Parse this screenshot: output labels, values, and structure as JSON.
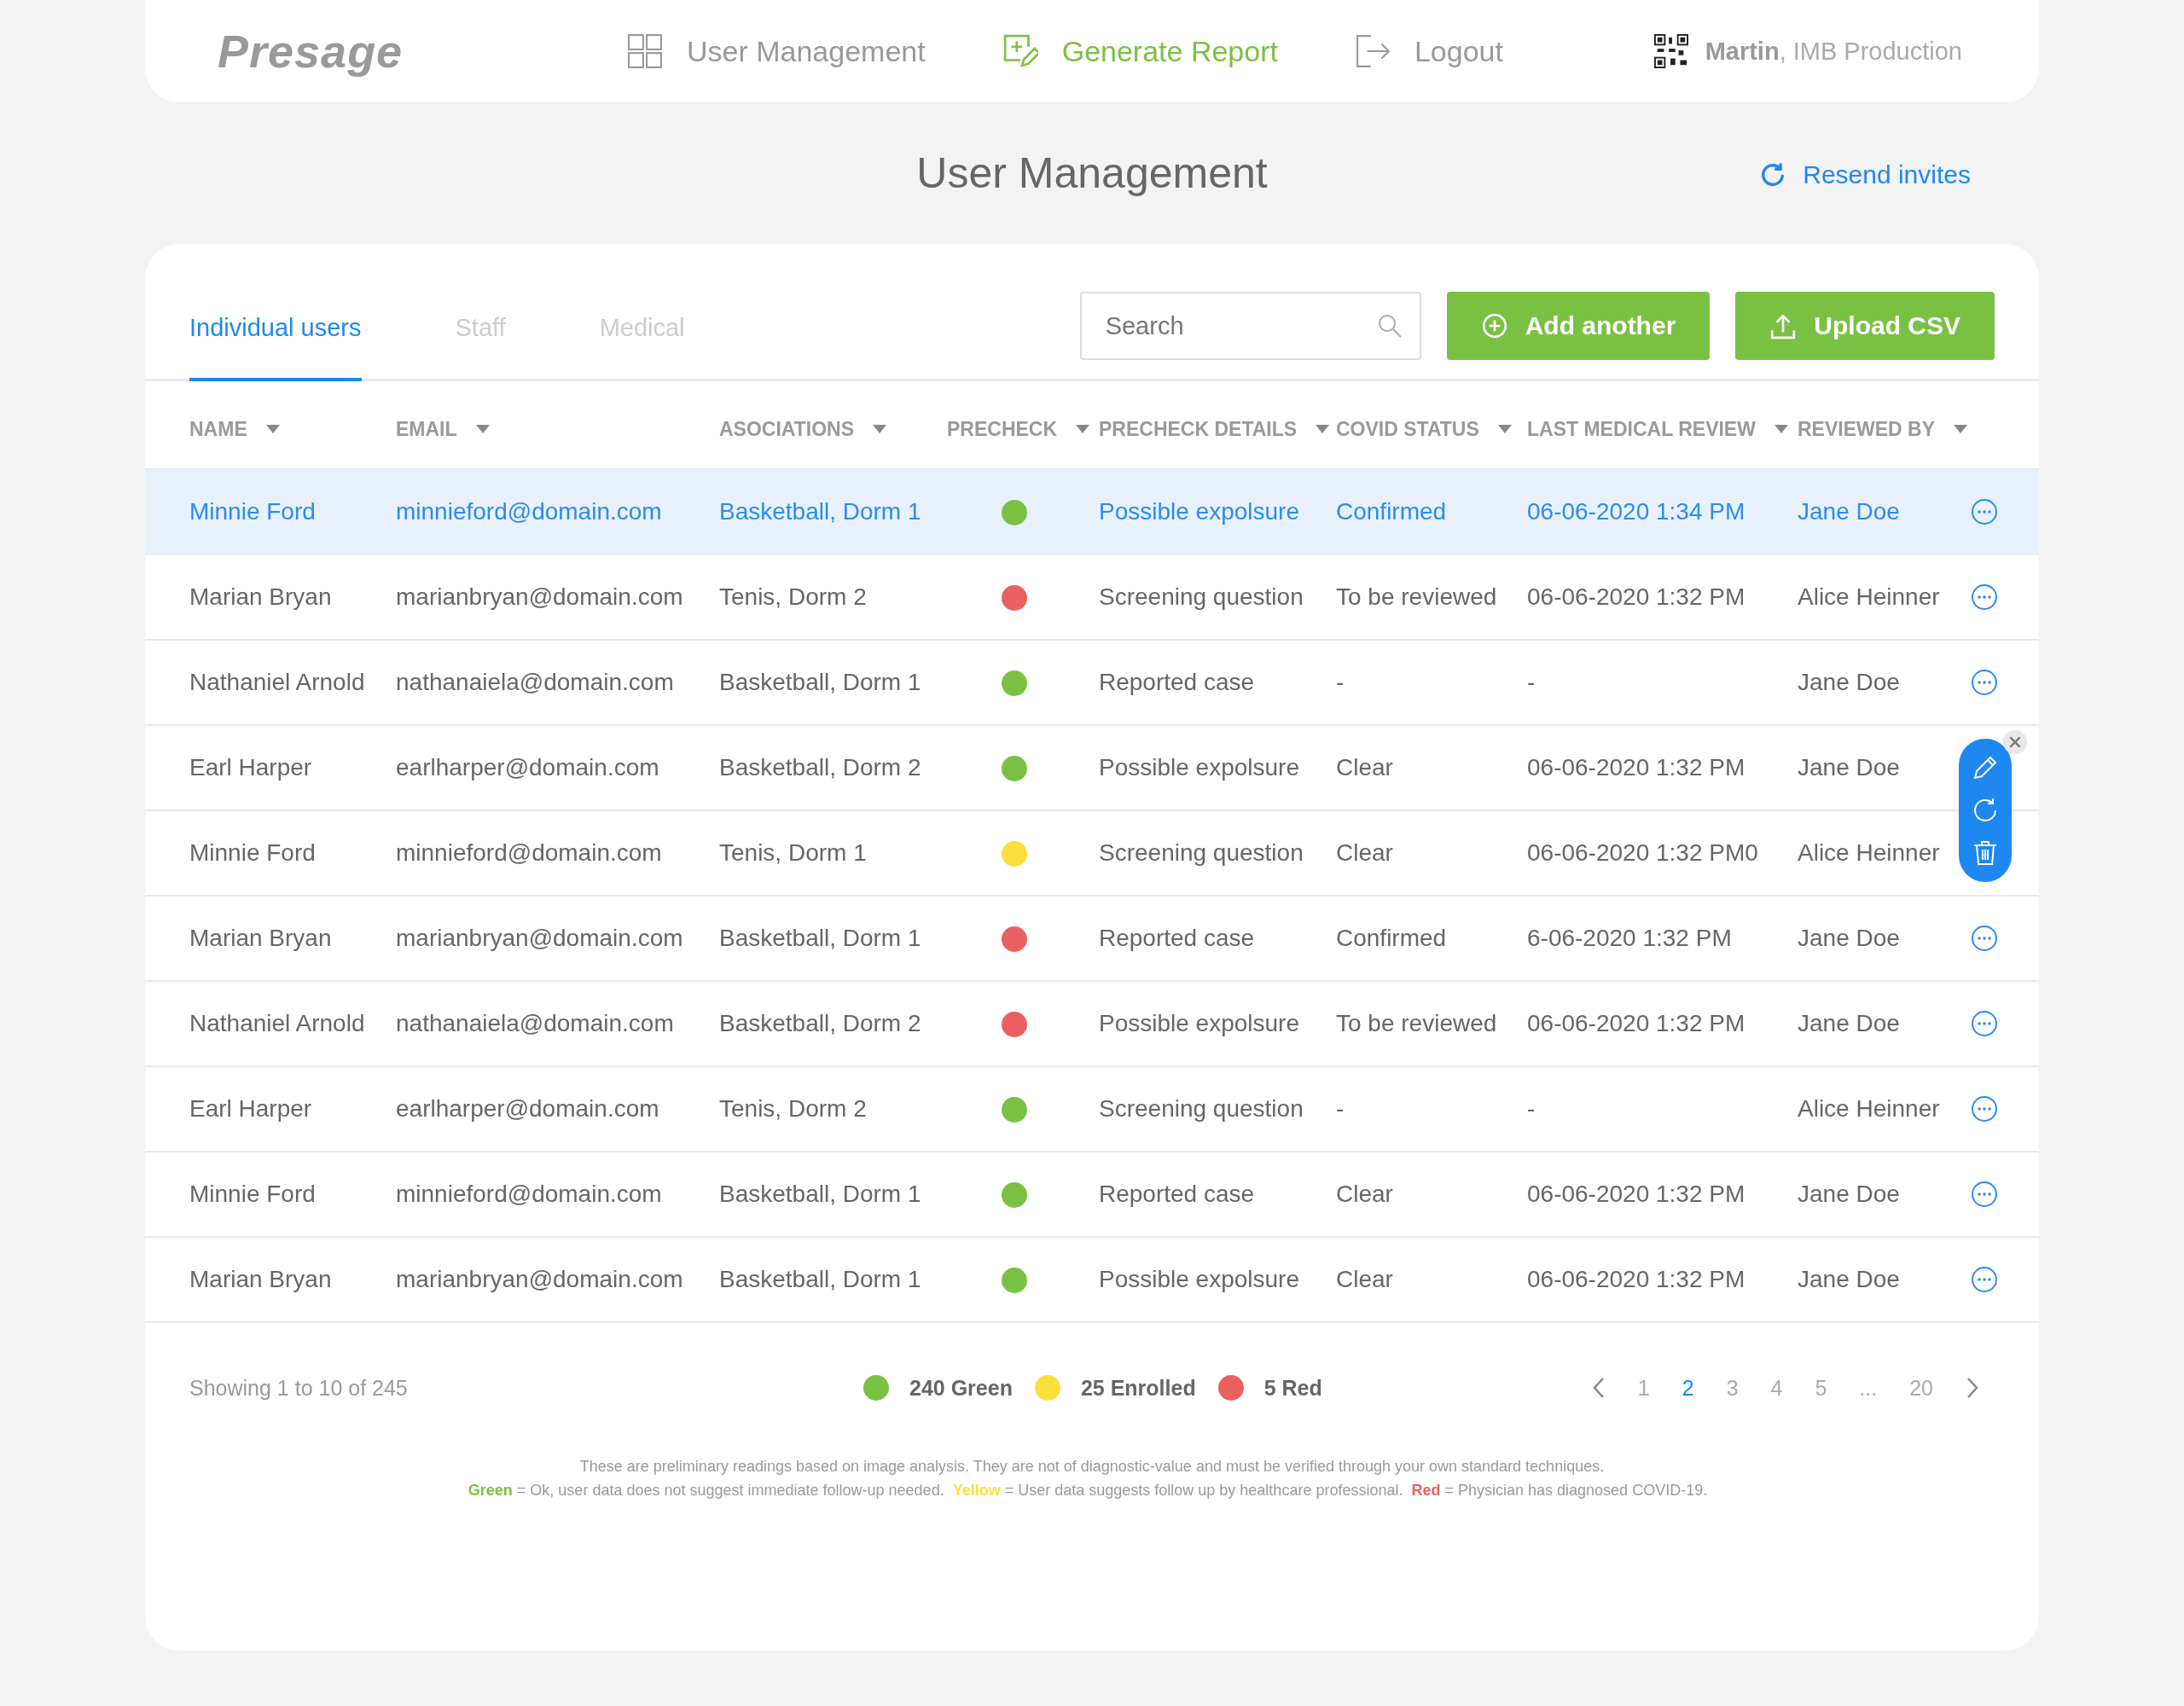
{
  "header": {
    "logo": "Presage",
    "nav": [
      {
        "label": "User Management",
        "selected": false
      },
      {
        "label": "Generate Report",
        "selected": true
      },
      {
        "label": "Logout",
        "selected": false
      }
    ],
    "user": {
      "name": "Martin",
      "org": ", IMB Production"
    }
  },
  "page_title": "User Management",
  "resend_link": "Resend invites",
  "tabs": [
    {
      "label": "Individual users",
      "selected": true
    },
    {
      "label": "Staff",
      "selected": false
    },
    {
      "label": "Medical",
      "selected": false
    }
  ],
  "search": {
    "placeholder": "Search"
  },
  "buttons": [
    {
      "label": "Add another",
      "kind": "add"
    },
    {
      "label": "Upload CSV",
      "kind": "upload"
    }
  ],
  "table": {
    "columns": [
      "NAME",
      "EMAIL",
      "ASOCIATIONS",
      "PRECHECK",
      "PRECHECK DETAILS",
      "COVID STATUS",
      "LAST MEDICAL REVIEW",
      "REVIEWED BY"
    ],
    "rows": [
      {
        "name": "Minnie Ford",
        "email": "minnieford@domain.com",
        "associations": "Basketball, Dorm 1",
        "color": "#7ac143",
        "details": "Possible expolsure",
        "covid_status": "Confirmed",
        "last_review": "06-06-2020 1:34 PM",
        "reviewed_by": "Jane Doe",
        "selected": true,
        "menu_open": false
      },
      {
        "name": "Marian Bryan",
        "email": "marianbryan@domain.com",
        "associations": "Tenis, Dorm 2",
        "color": "#ea6060",
        "details": "Screening question",
        "covid_status": "To be reviewed",
        "last_review": "06-06-2020 1:32 PM",
        "reviewed_by": "Alice Heinner",
        "selected": false,
        "menu_open": false
      },
      {
        "name": "Nathaniel Arnold",
        "email": "nathanaiela@domain.com",
        "associations": "Basketball, Dorm 1",
        "color": "#7ac143",
        "details": "Reported case",
        "covid_status": "-",
        "last_review": "-",
        "reviewed_by": "Jane Doe",
        "selected": false,
        "menu_open": false
      },
      {
        "name": "Earl Harper",
        "email": "earlharper@domain.com",
        "associations": "Basketball, Dorm 2",
        "color": "#7ac143",
        "details": "Possible expolsure",
        "covid_status": "Clear",
        "last_review": "06-06-2020 1:32 PM",
        "reviewed_by": "Jane Doe",
        "selected": false,
        "menu_open": true
      },
      {
        "name": "Minnie Ford",
        "email": "minnieford@domain.com",
        "associations": "Tenis, Dorm 1",
        "color": "#fddf3c",
        "details": "Screening question",
        "covid_status": "Clear",
        "last_review": "06-06-2020 1:32 PM0",
        "reviewed_by": "Alice Heinner",
        "selected": false,
        "menu_open": false
      },
      {
        "name": "Marian Bryan",
        "email": "marianbryan@domain.com",
        "associations": "Basketball, Dorm 1",
        "color": "#ea6060",
        "details": "Reported case",
        "covid_status": "Confirmed",
        "last_review": "6-06-2020 1:32 PM",
        "reviewed_by": "Jane Doe",
        "selected": false,
        "menu_open": false
      },
      {
        "name": "Nathaniel Arnold",
        "email": "nathanaiela@domain.com",
        "associations": "Basketball, Dorm 2",
        "color": "#ea6060",
        "details": "Possible expolsure",
        "covid_status": "To be reviewed",
        "last_review": "06-06-2020 1:32 PM",
        "reviewed_by": "Jane Doe",
        "selected": false,
        "menu_open": false
      },
      {
        "name": "Earl Harper",
        "email": "earlharper@domain.com",
        "associations": "Tenis, Dorm 2",
        "color": "#7ac143",
        "details": "Screening question",
        "covid_status": "-",
        "last_review": "-",
        "reviewed_by": "Alice Heinner",
        "selected": false,
        "menu_open": false
      },
      {
        "name": "Minnie Ford",
        "email": "minnieford@domain.com",
        "associations": "Basketball, Dorm 1",
        "color": "#7ac143",
        "details": "Reported case",
        "covid_status": "Clear",
        "last_review": "06-06-2020 1:32 PM",
        "reviewed_by": "Jane Doe",
        "selected": false,
        "menu_open": false
      },
      {
        "name": "Marian Bryan",
        "email": "marianbryan@domain.com",
        "associations": "Basketball, Dorm 1",
        "color": "#7ac143",
        "details": "Possible expolsure",
        "covid_status": "Clear",
        "last_review": "06-06-2020 1:32 PM",
        "reviewed_by": "Jane Doe",
        "selected": false,
        "menu_open": false
      }
    ]
  },
  "showing": "Showing 1 to 10 of 245",
  "legend": [
    {
      "label": "240 Green",
      "color": "#7ac143"
    },
    {
      "label": "25 Enrolled",
      "color": "#fddf3c"
    },
    {
      "label": "5 Red",
      "color": "#ea6060"
    }
  ],
  "pagination": [
    {
      "label": "1",
      "selected": false
    },
    {
      "label": "2",
      "selected": true
    },
    {
      "label": "3",
      "selected": false
    },
    {
      "label": "4",
      "selected": false
    },
    {
      "label": "5",
      "selected": false
    },
    {
      "label": "...",
      "selected": false
    },
    {
      "label": "20",
      "selected": false
    }
  ],
  "note": {
    "line1": "These are preliminary readings based on image analysis. They are not of diagnostic-value and must be verified through your own standard techniques.",
    "keys": [
      {
        "term": "Green",
        "color": "#7ac143",
        "text": " = Ok, user data does not suggest immediate follow-up needed."
      },
      {
        "term": "Yellow",
        "color": "#fddf3c",
        "text": " = User data suggests follow up by healthcare professional."
      },
      {
        "term": "Red",
        "color": "#ea6060",
        "text": " = Physician has diagnosed COVID-19."
      }
    ]
  }
}
